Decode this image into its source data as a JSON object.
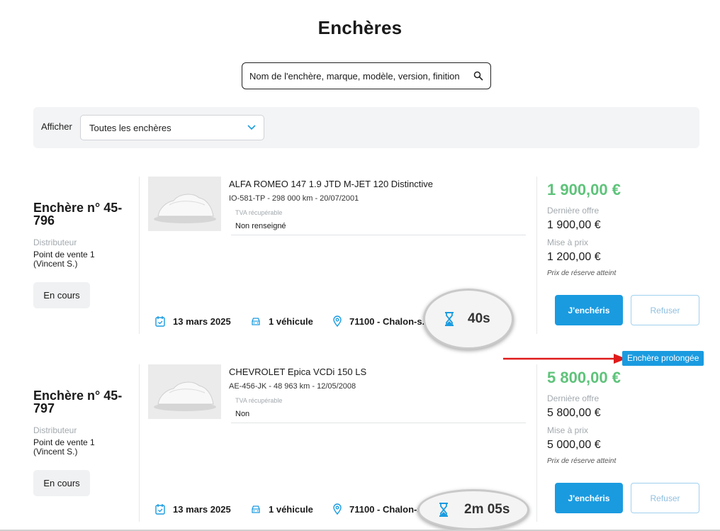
{
  "page": {
    "title": "Enchères"
  },
  "search": {
    "placeholder": "Nom de l'enchère, marque, modèle, version, finition",
    "icon": "search-icon"
  },
  "filter": {
    "label": "Afficher",
    "selected": "Toutes les enchères"
  },
  "colors": {
    "accent": "#1a9be0",
    "price": "#5ec37a",
    "arrow": "#e01a1a"
  },
  "auctions": [
    {
      "number": "Enchère n° 45-796",
      "distributor_label": "Distributeur",
      "distributor": "Point de vente 1 (Vincent S.)",
      "status": "En cours",
      "vehicle": {
        "title": "ALFA ROMEO 147 1.9 JTD M-JET 120 Distinctive",
        "subtitle": "IO-581-TP - 298 000 km - 20/07/2001",
        "tva_label": "TVA récupérable",
        "tva_value": "Non renseigné"
      },
      "date": "13 mars 2025",
      "vehicles_count": "1 véhicule",
      "location": "71100 - Chalon-s...",
      "timer": "40s",
      "price": "1 900,00 €",
      "last_offer_label": "Dernière offre",
      "last_offer": "1 900,00 €",
      "start_price_label": "Mise à prix",
      "start_price": "1 200,00 €",
      "reserve_note": "Prix de réserve atteint",
      "bid_label": "J'enchéris",
      "refuse_label": "Refuser"
    },
    {
      "number": "Enchère n° 45-797",
      "distributor_label": "Distributeur",
      "distributor": "Point de vente 1 (Vincent S.)",
      "status": "En cours",
      "vehicle": {
        "title": "CHEVROLET Epica VCDi 150 LS",
        "subtitle": "AE-456-JK - 48 963 km - 12/05/2008",
        "tva_label": "TVA récupérable",
        "tva_value": "Non"
      },
      "date": "13 mars 2025",
      "vehicles_count": "1 véhicule",
      "location": "71100 - Chalon-s...",
      "timer": "2m 05s",
      "price": "5 800,00 €",
      "last_offer_label": "Dernière offre",
      "last_offer": "5 800,00 €",
      "start_price_label": "Mise à prix",
      "start_price": "5 000,00 €",
      "reserve_note": "Prix de réserve atteint",
      "bid_label": "J'enchéris",
      "refuse_label": "Refuser",
      "extended_badge": "Enchère prolongée"
    }
  ]
}
